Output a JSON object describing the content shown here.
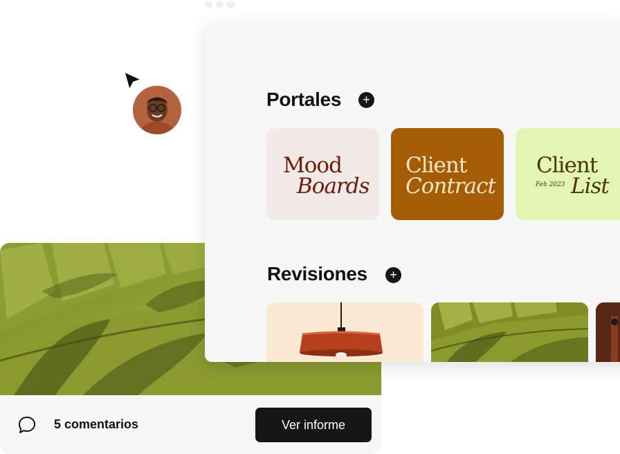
{
  "portals": {
    "title": "Portales",
    "add_icon": "plus-icon",
    "items": [
      {
        "line1": "Mood",
        "line2": "Boards",
        "bg": "#f0ebe6",
        "color": "#6b1a0d"
      },
      {
        "line1": "Client",
        "line2": "Contract",
        "bg": "#a35b04",
        "color": "#fde6c4"
      },
      {
        "line1": "Client",
        "line2": "List",
        "date": "Feb 2023",
        "bg": "#e3f5b3",
        "color": "#4a3500"
      }
    ]
  },
  "reviews": {
    "title": "Revisiones",
    "add_icon": "plus-icon",
    "thumbnails": [
      "pendant-lamp",
      "green-sofa",
      "chair"
    ]
  },
  "review_card": {
    "comments_icon": "speech-bubble-icon",
    "comments": "5 comentarios",
    "report_button": "Ver informe"
  },
  "colors": {
    "panel_bg": "#f7f7f7",
    "button_bg": "#161616",
    "sofa_green": "#8a9a2e"
  }
}
